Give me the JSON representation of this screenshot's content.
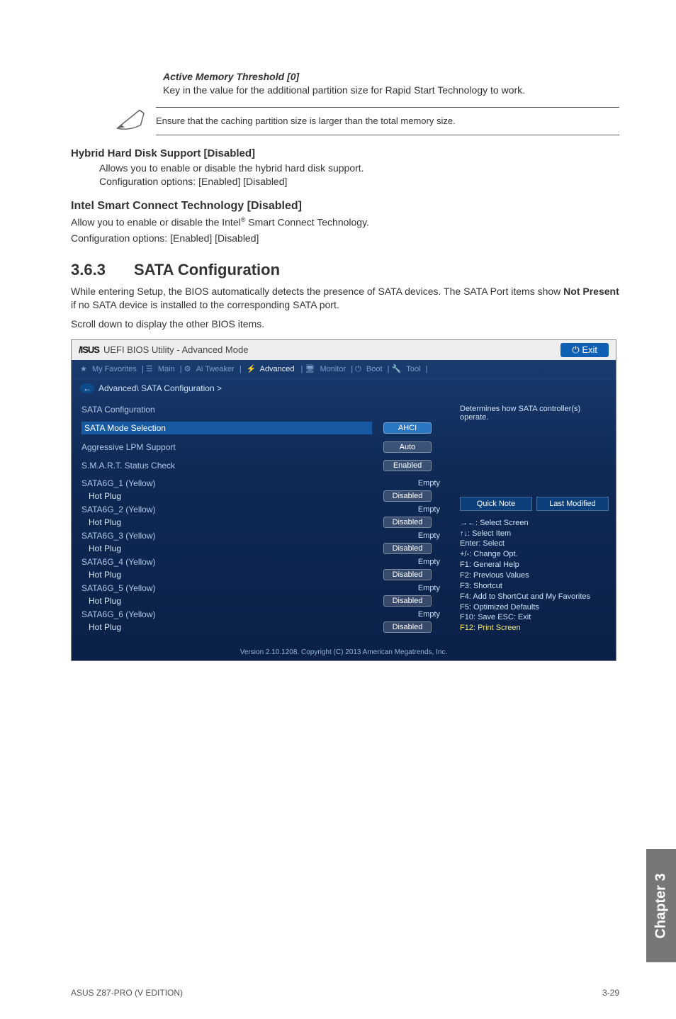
{
  "active_mem": {
    "title": "Active Memory Threshold [0]",
    "body": "Key in the value for the additional partition size for Rapid Start Technology to work."
  },
  "note": {
    "text": "Ensure that the caching partition size is larger than the total memory size."
  },
  "hybrid": {
    "title": "Hybrid Hard Disk Support [Disabled]",
    "line1": "Allows you to enable or disable the hybrid hard disk support.",
    "line2": "Configuration options: [Enabled] [Disabled]"
  },
  "smart": {
    "title": "Intel Smart Connect Technology [Disabled]",
    "line1": "Allow you to enable or disable the Intel",
    "line1_after": " Smart Connect Technology.",
    "line2": "Configuration options: [Enabled] [Disabled]"
  },
  "section": {
    "num": "3.6.3",
    "title": "SATA Configuration",
    "body1": "While entering Setup, the BIOS automatically detects the presence of SATA devices. The SATA Port items show ",
    "bold": "Not Present",
    "body1_after": " if no SATA device is installed to the corresponding SATA port.",
    "body2": "Scroll down to display the other BIOS items."
  },
  "bios": {
    "logo": "/ISUS",
    "title": " UEFI BIOS Utility - Advanced Mode",
    "exit": "Exit",
    "menu": {
      "fav": "My Favorites",
      "main": "Main",
      "ai": "Ai Tweaker",
      "adv": "Advanced",
      "mon": "Monitor",
      "boot": "Boot",
      "tool": "Tool"
    },
    "back": "Advanced\\ SATA Configuration >",
    "rows": {
      "conf": "SATA Configuration",
      "mode": "SATA Mode Selection",
      "mode_val": "AHCI",
      "lpm": "Aggressive LPM Support",
      "lpm_val": "Auto",
      "smart": "S.M.A.R.T. Status Check",
      "smart_val": "Enabled"
    },
    "ports": [
      {
        "name": "SATA6G_1 (Yellow)",
        "hp": "Hot Plug",
        "val": "Empty",
        "pill": "Disabled"
      },
      {
        "name": "SATA6G_2 (Yellow)",
        "hp": "Hot Plug",
        "val": "Empty",
        "pill": "Disabled"
      },
      {
        "name": "SATA6G_3 (Yellow)",
        "hp": "Hot Plug",
        "val": "Empty",
        "pill": "Disabled"
      },
      {
        "name": "SATA6G_4 (Yellow)",
        "hp": "Hot Plug",
        "val": "Empty",
        "pill": "Disabled"
      },
      {
        "name": "SATA6G_5 (Yellow)",
        "hp": "Hot Plug",
        "val": "Empty",
        "pill": "Disabled"
      },
      {
        "name": "SATA6G_6 (Yellow)",
        "hp": "Hot Plug",
        "val": "Empty",
        "pill": "Disabled"
      }
    ],
    "right": {
      "desc": "Determines how SATA controller(s) operate.",
      "quick": "Quick Note",
      "last": "Last Modified",
      "help1": "→←: Select Screen",
      "help2": "↑↓: Select Item",
      "help3": "Enter: Select",
      "help4": "+/-: Change Opt.",
      "help5": "F1: General Help",
      "help6": "F2: Previous Values",
      "help7": "F3: Shortcut",
      "help8": "F4: Add to ShortCut and My Favorites",
      "help9": "F5: Optimized Defaults",
      "help10": "F10: Save  ESC: Exit",
      "help11": "F12: Print Screen"
    },
    "footer": "Version 2.10.1208. Copyright (C) 2013 American Megatrends, Inc."
  },
  "chapter": "Chapter 3",
  "footer": {
    "left": "ASUS Z87-PRO (V EDITION)",
    "right": "3-29"
  }
}
